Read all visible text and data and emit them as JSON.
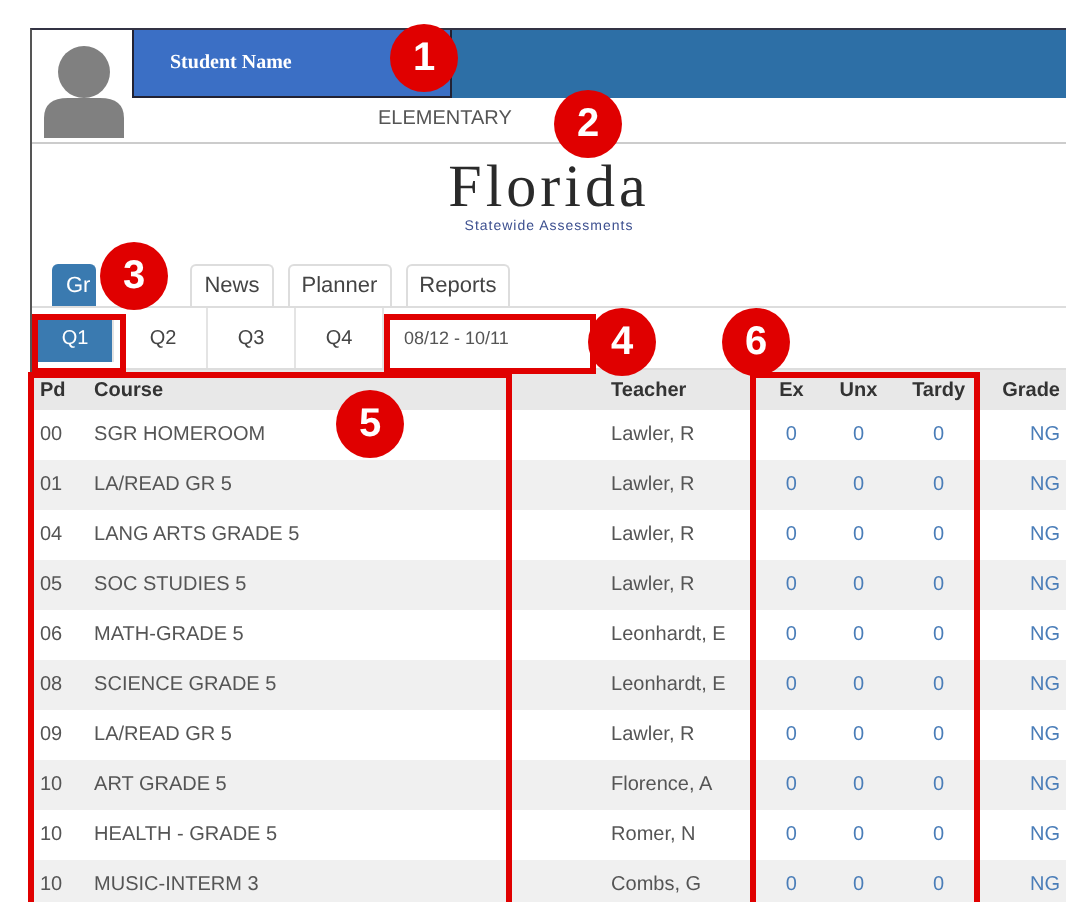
{
  "header": {
    "student_name": "Student Name",
    "school": "ELEMENTARY"
  },
  "logo": {
    "title": "Florida",
    "subtitle": "Statewide Assessments"
  },
  "tabs": [
    {
      "label": "Gr",
      "selected": true
    },
    {
      "label": "News",
      "selected": false
    },
    {
      "label": "Planner",
      "selected": false
    },
    {
      "label": "Reports",
      "selected": false
    }
  ],
  "quarters": [
    {
      "label": "Q1",
      "selected": true
    },
    {
      "label": "Q2",
      "selected": false
    },
    {
      "label": "Q3",
      "selected": false
    },
    {
      "label": "Q4",
      "selected": false
    }
  ],
  "date_range": "08/12 - 10/11",
  "table": {
    "columns": [
      "Pd",
      "Course",
      "Teacher",
      "Ex",
      "Unx",
      "Tardy",
      "Grade"
    ],
    "rows": [
      [
        "00",
        "SGR HOMEROOM",
        "Lawler, R",
        "0",
        "0",
        "0",
        "NG"
      ],
      [
        "01",
        "LA/READ GR 5",
        "Lawler, R",
        "0",
        "0",
        "0",
        "NG"
      ],
      [
        "04",
        "LANG ARTS GRADE 5",
        "Lawler, R",
        "0",
        "0",
        "0",
        "NG"
      ],
      [
        "05",
        "SOC STUDIES 5",
        "Lawler, R",
        "0",
        "0",
        "0",
        "NG"
      ],
      [
        "06",
        "MATH-GRADE 5",
        "Leonhardt, E",
        "0",
        "0",
        "0",
        "NG"
      ],
      [
        "08",
        "SCIENCE GRADE 5",
        "Leonhardt, E",
        "0",
        "0",
        "0",
        "NG"
      ],
      [
        "09",
        "LA/READ GR 5",
        "Lawler, R",
        "0",
        "0",
        "0",
        "NG"
      ],
      [
        "10",
        "ART GRADE 5",
        "Florence, A",
        "0",
        "0",
        "0",
        "NG"
      ],
      [
        "10",
        "HEALTH - GRADE 5",
        "Romer, N",
        "0",
        "0",
        "0",
        "NG"
      ],
      [
        "10",
        "MUSIC-INTERM 3",
        "Combs, G",
        "0",
        "0",
        "0",
        "NG"
      ]
    ]
  },
  "annotations": {
    "markers": [
      "1",
      "2",
      "3",
      "4",
      "5",
      "6"
    ]
  }
}
